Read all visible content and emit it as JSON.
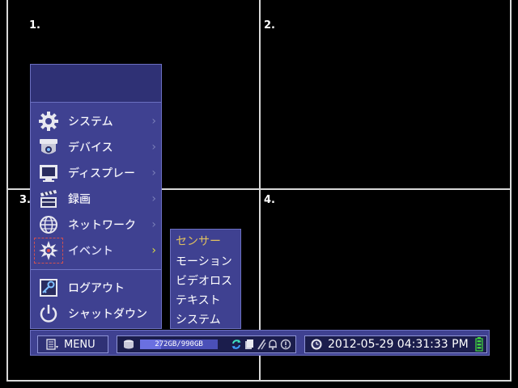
{
  "channels": [
    {
      "label": "1."
    },
    {
      "label": "2."
    },
    {
      "label": "3."
    },
    {
      "label": "4."
    }
  ],
  "menu": {
    "items": [
      {
        "label": "システム",
        "icon": "gear-icon",
        "arrow": "›"
      },
      {
        "label": "デバイス",
        "icon": "camera-icon",
        "arrow": "›"
      },
      {
        "label": "ディスプレー",
        "icon": "monitor-icon",
        "arrow": "›"
      },
      {
        "label": "録画",
        "icon": "clapperboard-icon",
        "arrow": "›"
      },
      {
        "label": "ネットワーク",
        "icon": "globe-icon",
        "arrow": "›"
      },
      {
        "label": "イベント",
        "icon": "alarm-burst-icon",
        "arrow": "›",
        "active": true
      }
    ],
    "actions": [
      {
        "label": "ログアウト",
        "icon": "logout-key-icon"
      },
      {
        "label": "シャットダウン",
        "icon": "power-icon"
      }
    ]
  },
  "submenu": {
    "items": [
      {
        "label": "センサー",
        "active": true
      },
      {
        "label": "モーション"
      },
      {
        "label": "ビデオロス"
      },
      {
        "label": "テキスト"
      },
      {
        "label": "システム"
      }
    ]
  },
  "statusbar": {
    "menu_label": "MENU",
    "storage_text": "272GB/990GB",
    "storage_used_fraction": 0.275,
    "datetime": "2012-05-29 04:31:33 PM"
  },
  "colors": {
    "panel": "#3f4191",
    "panel_dark": "#2f3175",
    "border": "#6b6fc0",
    "active_arrow": "#dddd40",
    "submenu_active": "#e0c060"
  }
}
